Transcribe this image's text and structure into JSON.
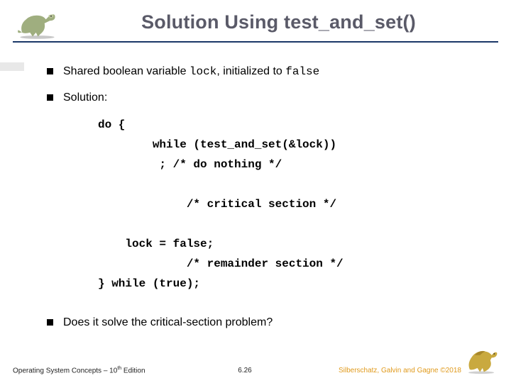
{
  "title": "Solution Using test_and_set()",
  "bullets": {
    "b1_pre": "Shared boolean variable ",
    "b1_code1": "lock",
    "b1_mid": ", initialized to ",
    "b1_code2": "false",
    "b2": "Solution:",
    "b3": "Does it solve the critical-section problem?"
  },
  "code": {
    "l1": "do {",
    "l2": "        while (test_and_set(&lock))",
    "l3": "         ; /* do nothing */",
    "l4": "",
    "l5": "             /* critical section */",
    "l6": "",
    "l7": "    lock = false;",
    "l8": "             /* remainder section */",
    "l9": "} while (true);"
  },
  "footer": {
    "left_a": "Operating System Concepts – 10",
    "left_sup": "th",
    "left_b": " Edition",
    "center": "6.26",
    "right": "Silberschatz, Galvin and Gagne ©2018"
  }
}
